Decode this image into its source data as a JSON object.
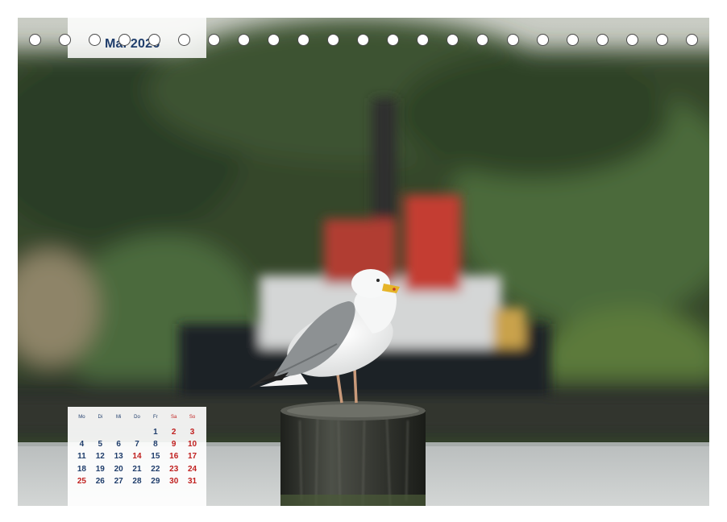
{
  "month_label": "Mai 2026",
  "calendar": {
    "weekdays": [
      "Mo",
      "Di",
      "Mi",
      "Do",
      "Fr",
      "Sa",
      "So"
    ],
    "weeks": [
      [
        "",
        "",
        "",
        "",
        "1",
        "2",
        "3"
      ],
      [
        "4",
        "5",
        "6",
        "7",
        "8",
        "9",
        "10"
      ],
      [
        "11",
        "12",
        "13",
        "14",
        "15",
        "16",
        "17"
      ],
      [
        "18",
        "19",
        "20",
        "21",
        "22",
        "23",
        "24"
      ],
      [
        "25",
        "26",
        "27",
        "28",
        "29",
        "30",
        "31"
      ]
    ],
    "holidays": [
      "14",
      "25"
    ],
    "colors": {
      "weekday": "#1f3d6b",
      "weekend": "#c0201f"
    }
  },
  "photo_subject": "seagull-on-wooden-post"
}
